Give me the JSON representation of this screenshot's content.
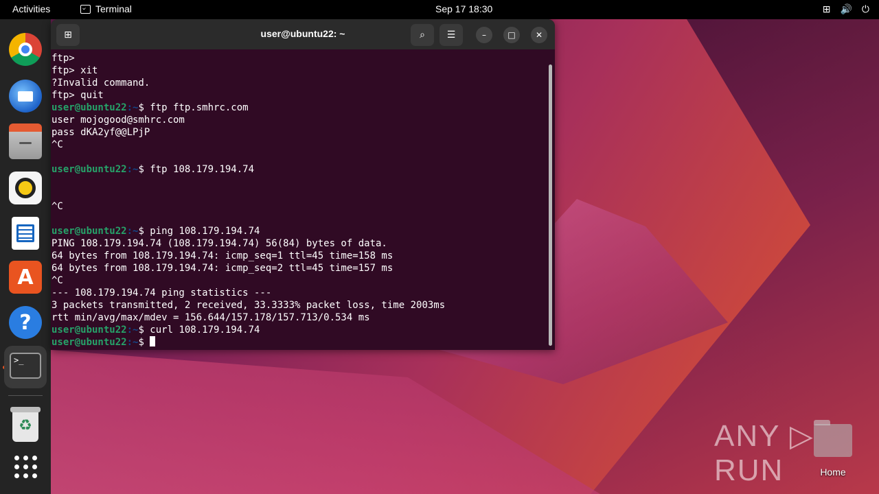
{
  "topbar": {
    "activities": "Activities",
    "app_name": "Terminal",
    "clock": "Sep 17  18:30",
    "tray": [
      "⊞",
      "🔊",
      "⏻"
    ]
  },
  "dock": {
    "items": [
      "Google Chrome",
      "Thunderbird Mail",
      "Files",
      "Rhythmbox",
      "LibreOffice Writer",
      "Ubuntu Software",
      "Help",
      "Terminal",
      "Trash",
      "Show Applications"
    ],
    "terminal_glyph": ">_",
    "help_glyph": "?",
    "appcenter_glyph": "A",
    "trash_glyph": "♻"
  },
  "terminal": {
    "title": "user@ubuntu22: ~",
    "prompt_user": "user@ubuntu22",
    "prompt_path": ":~",
    "prompt_sign": "$ ",
    "lines": [
      {
        "type": "out",
        "text": "ftp>"
      },
      {
        "type": "out",
        "text": "ftp> xit"
      },
      {
        "type": "out",
        "text": "?Invalid command."
      },
      {
        "type": "out",
        "text": "ftp> quit"
      },
      {
        "type": "cmd",
        "text": "ftp ftp.smhrc.com"
      },
      {
        "type": "out",
        "text": "user mojogood@smhrc.com"
      },
      {
        "type": "out",
        "text": "pass dKA2yf@@LPjP"
      },
      {
        "type": "out",
        "text": "^C"
      },
      {
        "type": "out",
        "text": ""
      },
      {
        "type": "cmd",
        "text": "ftp 108.179.194.74"
      },
      {
        "type": "out",
        "text": ""
      },
      {
        "type": "out",
        "text": ""
      },
      {
        "type": "out",
        "text": "^C"
      },
      {
        "type": "out",
        "text": ""
      },
      {
        "type": "cmd",
        "text": "ping 108.179.194.74"
      },
      {
        "type": "out",
        "text": "PING 108.179.194.74 (108.179.194.74) 56(84) bytes of data."
      },
      {
        "type": "out",
        "text": "64 bytes from 108.179.194.74: icmp_seq=1 ttl=45 time=158 ms"
      },
      {
        "type": "out",
        "text": "64 bytes from 108.179.194.74: icmp_seq=2 ttl=45 time=157 ms"
      },
      {
        "type": "out",
        "text": "^C"
      },
      {
        "type": "out",
        "text": "--- 108.179.194.74 ping statistics ---"
      },
      {
        "type": "out",
        "text": "3 packets transmitted, 2 received, 33.3333% packet loss, time 2003ms"
      },
      {
        "type": "out",
        "text": "rtt min/avg/max/mdev = 156.644/157.178/157.713/0.534 ms"
      },
      {
        "type": "cmd",
        "text": "curl 108.179.194.74"
      },
      {
        "type": "cursor",
        "text": ""
      }
    ]
  },
  "desktop": {
    "home_label": "Home",
    "watermark": "ANY ▷ RUN"
  }
}
